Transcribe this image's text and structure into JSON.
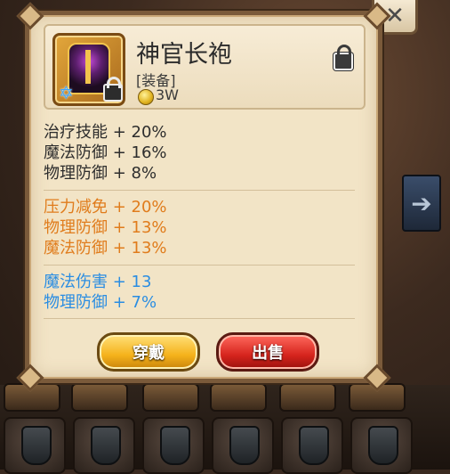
{
  "item": {
    "name": "神官长袍",
    "type": "[装备]",
    "price": "3W"
  },
  "stats": {
    "base": [
      {
        "text": "治疗技能 + 20%"
      },
      {
        "text": "魔法防御 + 16%"
      },
      {
        "text": "物理防御 + 8%"
      }
    ],
    "bonus": [
      {
        "text": "压力减免 + 20%"
      },
      {
        "text": "物理防御 + 13%"
      },
      {
        "text": "魔法防御 + 13%"
      }
    ],
    "extra": [
      {
        "text": "魔法伤害 + 13"
      },
      {
        "text": "物理防御 + 7%"
      }
    ]
  },
  "buttons": {
    "equip": "穿戴",
    "sell": "出售"
  },
  "colors": {
    "base_stat": "#2d2d2d",
    "bonus_stat": "#e07c1c",
    "extra_stat": "#2a8de2"
  }
}
